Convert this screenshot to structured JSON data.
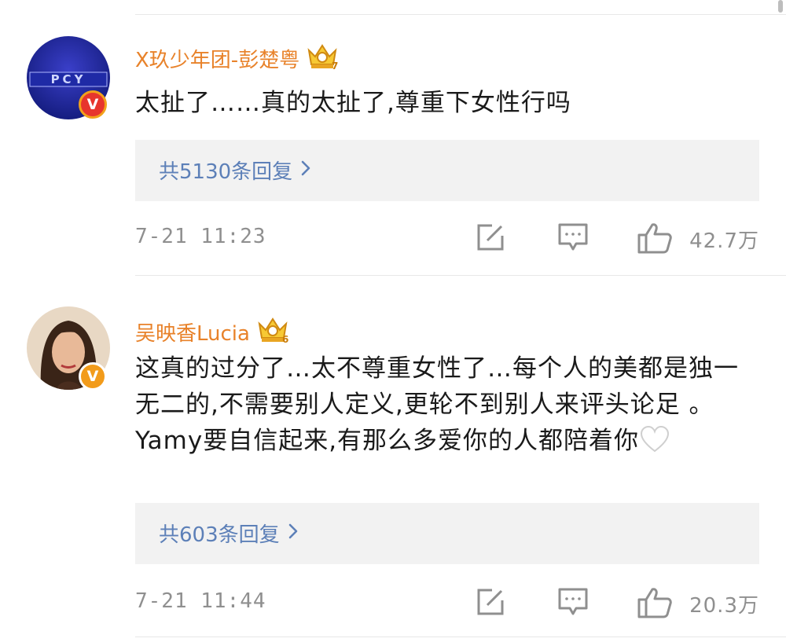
{
  "comments": [
    {
      "username": "X玖少年团-彭楚粤",
      "crown_level": "7",
      "badge": "V",
      "avatar_text": "PCY",
      "text": "太扯了……真的太扯了,尊重下女性行吗",
      "reply_text": "共5130条回复",
      "timestamp": "7-21 11:23",
      "likes": "42.7万"
    },
    {
      "username": "吴映香Lucia",
      "crown_level": "6",
      "badge": "V",
      "text": "这真的过分了…太不尊重女性了…每个人的美都是独一无二的,不需要别人定义,更轮不到别人来评头论足 。Yamy要自信起来,有那么多爱你的人都陪着你",
      "reply_text": "共603条回复",
      "timestamp": "7-21 11:44",
      "likes": "20.3万"
    }
  ],
  "colors": {
    "username": "#e8822a",
    "reply_link": "#5d80b8",
    "meta_gray": "#8f8f8f",
    "reply_bg": "#f2f2f2"
  }
}
